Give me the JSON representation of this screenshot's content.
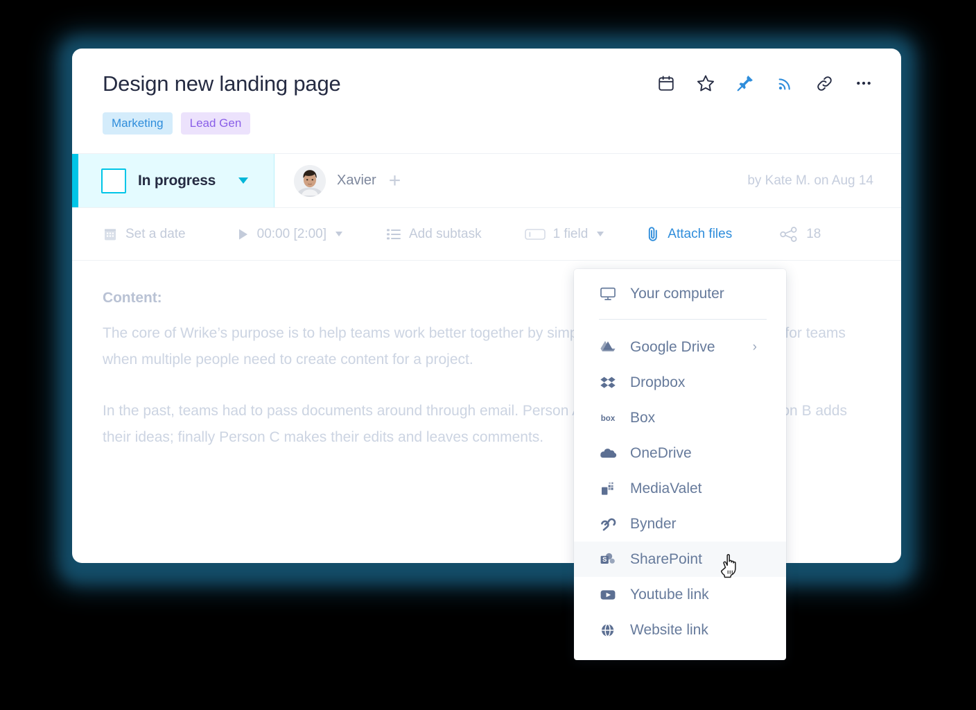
{
  "task": {
    "title": "Design new landing page",
    "tags": [
      {
        "label": "Marketing",
        "color": "#2f8ddb",
        "bg": "#d4ecfb"
      },
      {
        "label": "Lead Gen",
        "color": "#8a5fe8",
        "bg": "#ece2fc"
      }
    ]
  },
  "header_actions": [
    {
      "name": "calendar-icon",
      "label": "Calendar"
    },
    {
      "name": "star-icon",
      "label": "Add to favorites"
    },
    {
      "name": "pin-icon",
      "label": "Pin task"
    },
    {
      "name": "follow-icon",
      "label": "Follow"
    },
    {
      "name": "link-icon",
      "label": "Copy link"
    },
    {
      "name": "more-icon",
      "label": "More options"
    }
  ],
  "status": {
    "label": "In progress",
    "accent_color": "#00c5e7",
    "background": "#e4fbff",
    "assignee": "Xavier",
    "add_person_label": "+",
    "byline": "by Kate M. on Aug 14"
  },
  "toolbar": {
    "set_date": "Set a date",
    "timer": "00:00 [2:00]",
    "add_subtask": "Add subtask",
    "fields": "1 field",
    "attach_files": "Attach files",
    "attach_color": "#2f8ddb",
    "share_count": "18"
  },
  "content": {
    "heading": "Content:",
    "paragraph1": "The core of Wrike’s purpose is to help teams work better together by simplifying the collaboration process for teams when multiple people need to create content for a project.",
    "paragraph2": "In the past, teams had to pass documents around through email. Person A makes their version; then Person B adds their ideas; finally Person C makes their edits and leaves comments."
  },
  "attach_menu": {
    "items": [
      {
        "label": "Your computer",
        "icon": "monitor-icon",
        "has_submenu": false,
        "highlighted": false
      },
      {
        "label": "Google Drive",
        "icon": "google-drive-icon",
        "has_submenu": true,
        "submenu_chevron": "›",
        "highlighted": false
      },
      {
        "label": "Dropbox",
        "icon": "dropbox-icon",
        "has_submenu": false,
        "highlighted": false
      },
      {
        "label": "Box",
        "icon": "box-icon",
        "has_submenu": false,
        "highlighted": false
      },
      {
        "label": "OneDrive",
        "icon": "onedrive-icon",
        "has_submenu": false,
        "highlighted": false
      },
      {
        "label": "MediaValet",
        "icon": "mediavalet-icon",
        "has_submenu": false,
        "highlighted": false
      },
      {
        "label": "Bynder",
        "icon": "bynder-icon",
        "has_submenu": false,
        "highlighted": false
      },
      {
        "label": "SharePoint",
        "icon": "sharepoint-icon",
        "has_submenu": false,
        "highlighted": true
      },
      {
        "label": "Youtube link",
        "icon": "youtube-icon",
        "has_submenu": false,
        "highlighted": false
      },
      {
        "label": "Website link",
        "icon": "globe-icon",
        "has_submenu": false,
        "highlighted": false
      }
    ]
  }
}
